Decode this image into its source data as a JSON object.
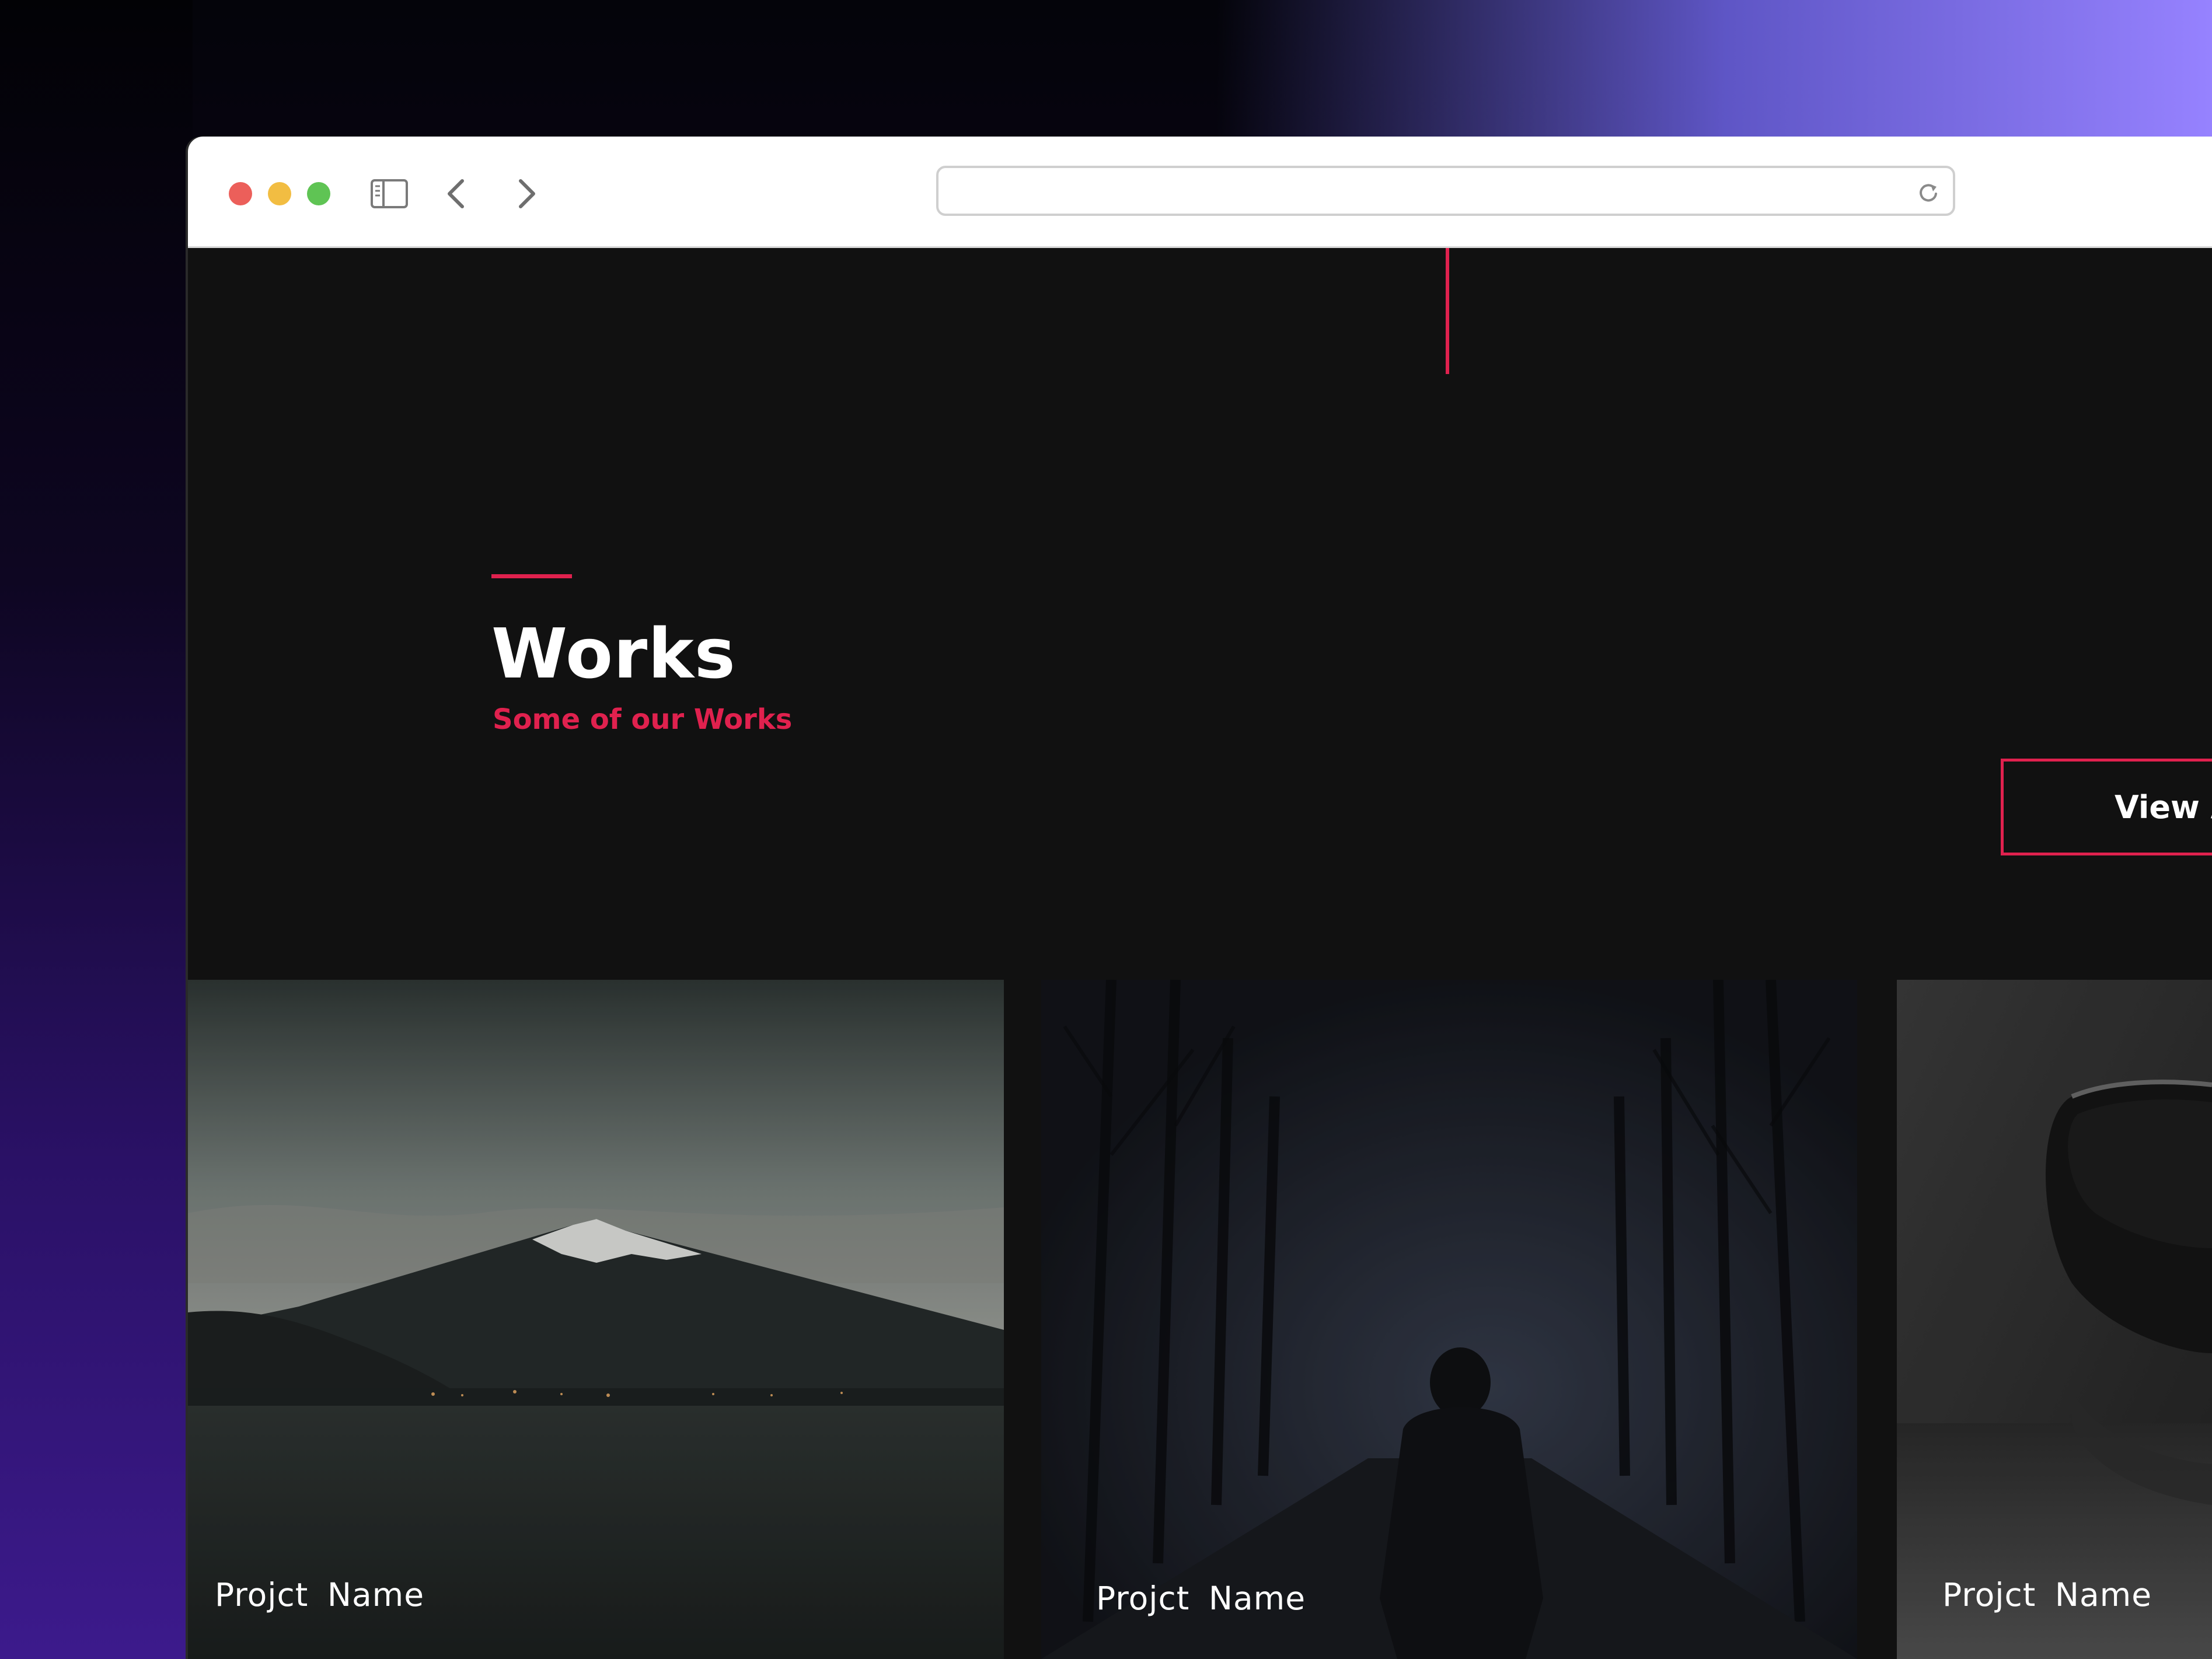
{
  "browser": {
    "address": {
      "value": "",
      "placeholder": ""
    }
  },
  "works": {
    "title": "Works",
    "subtitle": "Some of our Works",
    "view_all_label": "View A",
    "accent_color": "#e0214e"
  },
  "projects": [
    {
      "label": "Projct  Name",
      "image": "mountain-lake-photo"
    },
    {
      "label": "Projct  Name",
      "image": "hooded-figure-forest-photo"
    },
    {
      "label": "Projct  Name",
      "image": "dark-cup-photo"
    }
  ]
}
